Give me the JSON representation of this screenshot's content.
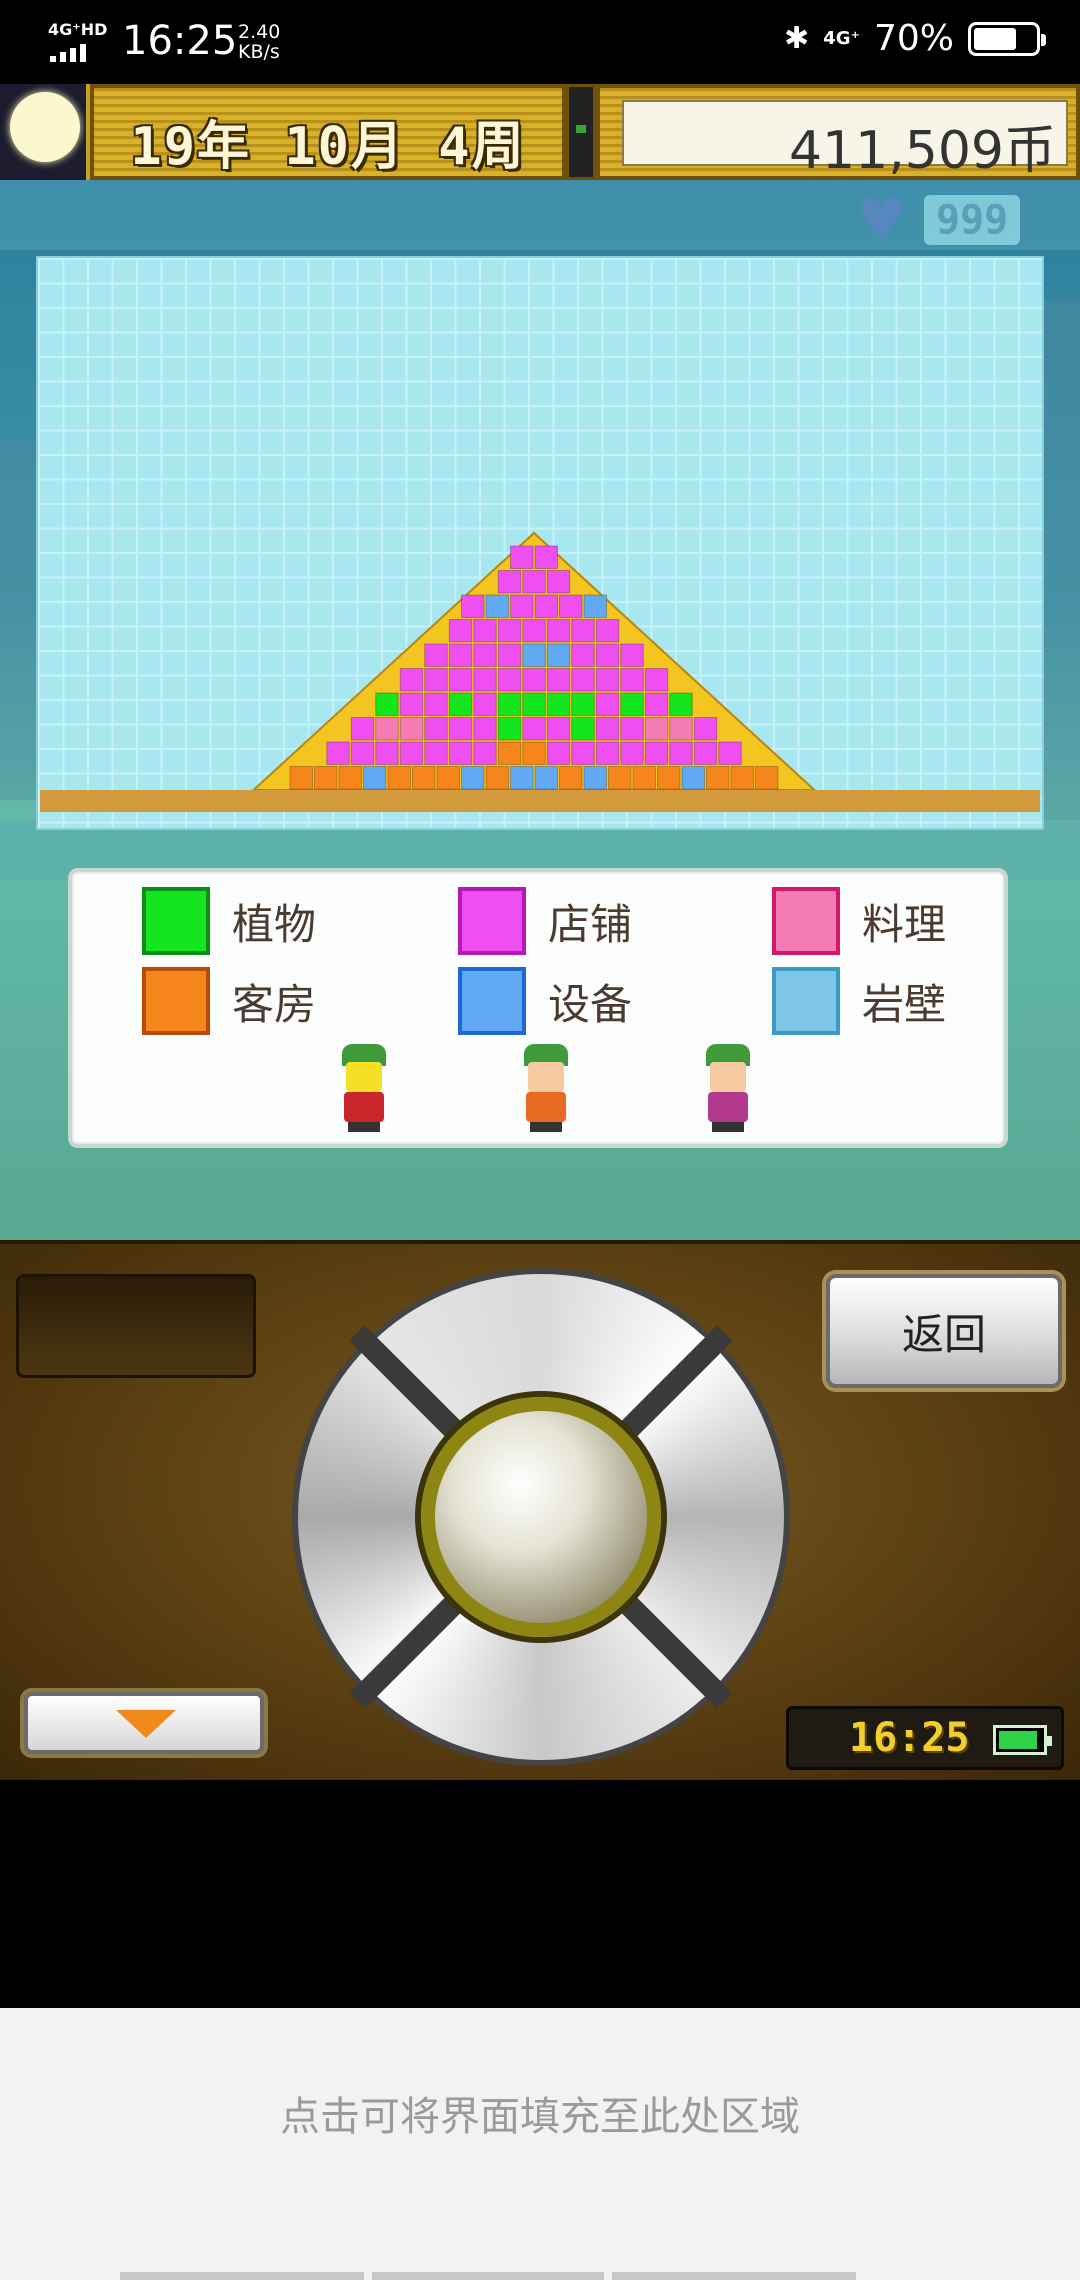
{
  "status_bar": {
    "network": "4G⁺HD",
    "time": "16:25",
    "speed_value": "2.40",
    "speed_unit": "KB/s",
    "bluetooth_icon": "bluetooth-icon",
    "network_right": "4G⁺",
    "battery_percent": "70%",
    "battery_level": 0.7
  },
  "game_header": {
    "date": "19年 10月 4周",
    "money": "411,509币",
    "moon_icon": "moon-icon"
  },
  "badge": {
    "heart_icon": "heart-icon",
    "value": "999"
  },
  "legend": {
    "items": [
      {
        "label": "植物",
        "color": "#13e51e",
        "border": "#0b8e16"
      },
      {
        "label": "店铺",
        "color": "#ef4ff0",
        "border": "#b517b8"
      },
      {
        "label": "料理",
        "color": "#f57bb3",
        "border": "#d2196a"
      },
      {
        "label": "客房",
        "color": "#f6861c",
        "border": "#b74c06"
      },
      {
        "label": "设备",
        "color": "#62a9f3",
        "border": "#1e67d8"
      },
      {
        "label": "岩壁",
        "color": "#7cc6e8",
        "border": "#3e9ac4"
      }
    ]
  },
  "pyramid": {
    "colors": {
      "plant": "#13e51e",
      "shop": "#ef4ff0",
      "food": "#f57bb3",
      "room": "#f6861c",
      "equip": "#62a9f3",
      "slope": "#f3c521",
      "ground": "#d29a3a"
    }
  },
  "controller": {
    "back_label": "返回",
    "down_icon": "arrow-down-icon",
    "clock": "16:25"
  },
  "fill_hint": {
    "text": "点击可将界面填充至此处区域"
  }
}
